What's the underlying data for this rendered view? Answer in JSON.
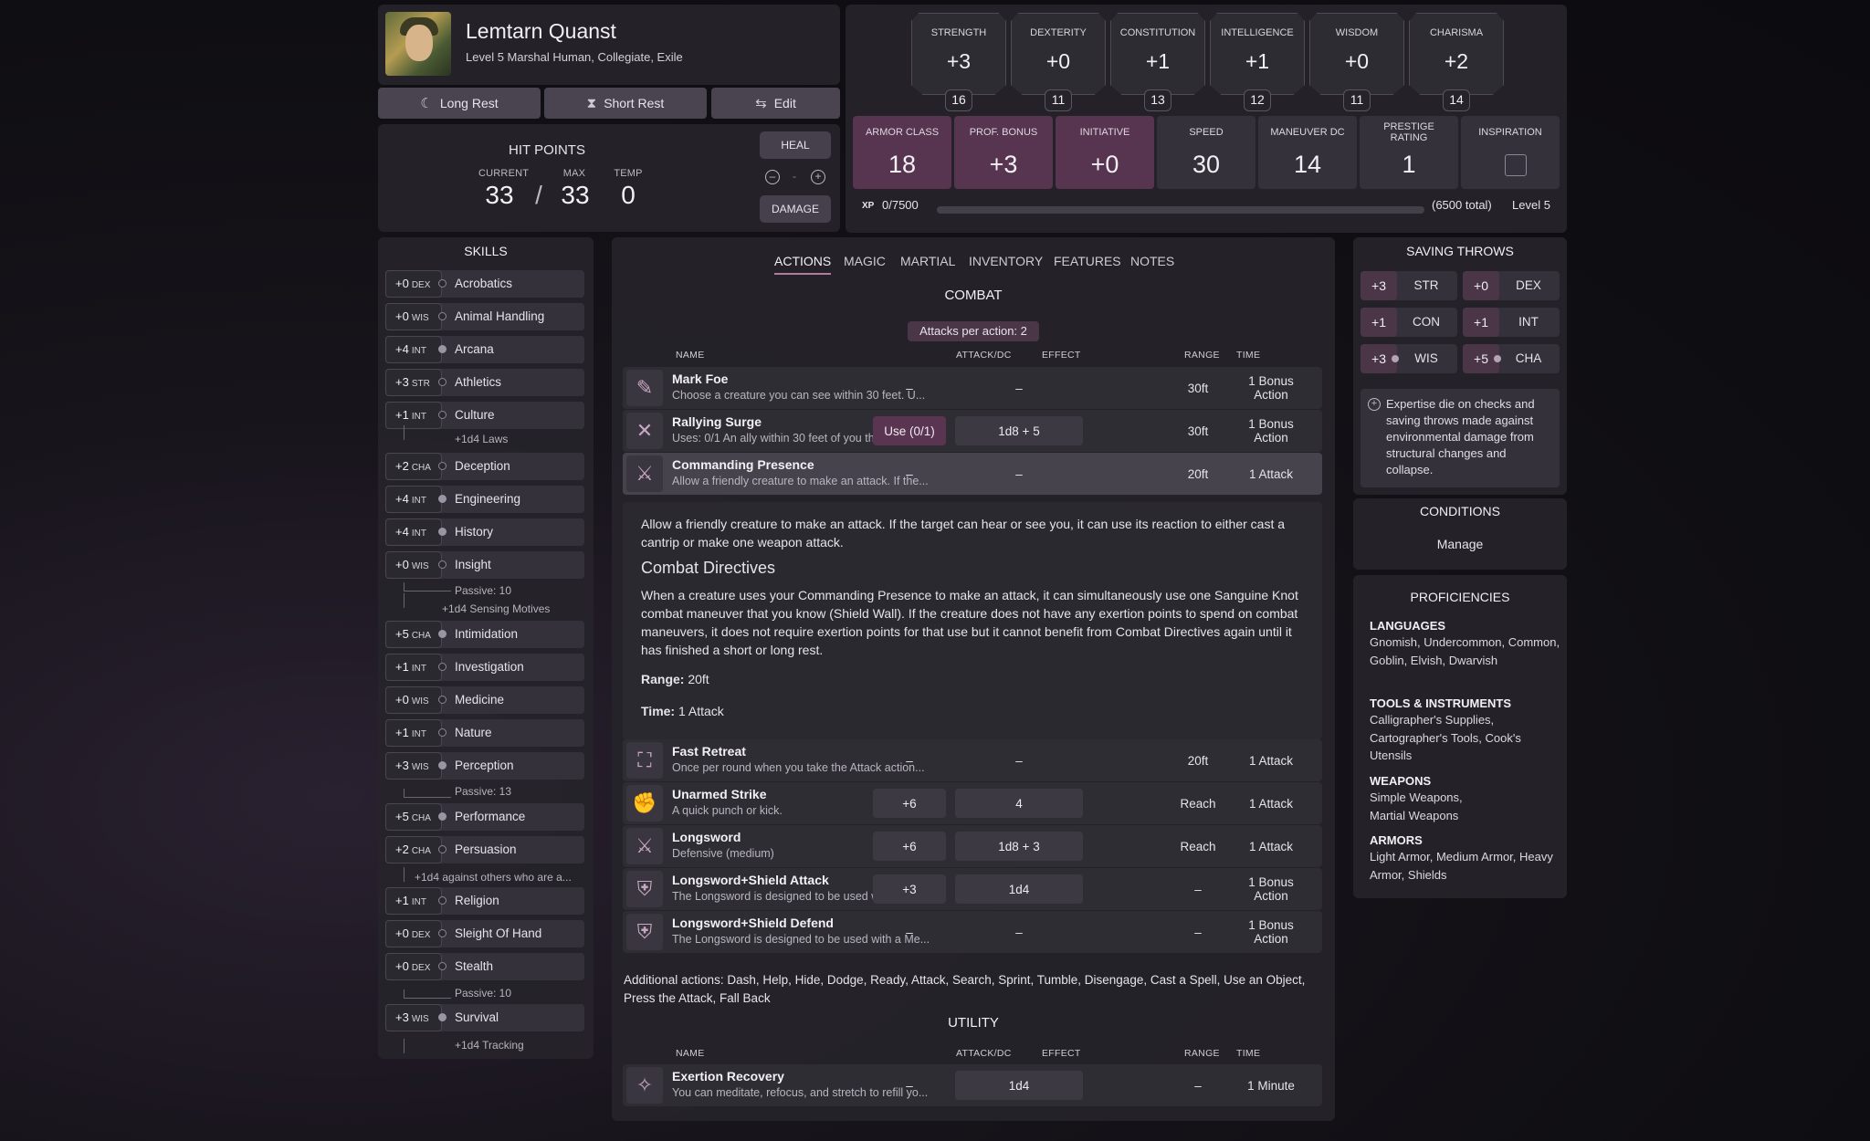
{
  "character": {
    "name": "Lemtarn Quanst",
    "subtitle": "Level 5 Marshal Human, Collegiate, Exile"
  },
  "buttons": {
    "long_rest": "Long Rest",
    "short_rest": "Short Rest",
    "edit": "Edit",
    "heal": "HEAL",
    "damage": "DAMAGE",
    "minus": "–",
    "plus": "+",
    "dash": "-"
  },
  "hp": {
    "title": "HIT POINTS",
    "current_label": "CURRENT",
    "max_label": "MAX",
    "temp_label": "TEMP",
    "current": "33",
    "sep": "/",
    "max": "33",
    "temp": "0"
  },
  "abilities": [
    {
      "name": "STRENGTH",
      "mod": "+3",
      "score": "16"
    },
    {
      "name": "DEXTERITY",
      "mod": "+0",
      "score": "11"
    },
    {
      "name": "CONSTITUTION",
      "mod": "+1",
      "score": "13"
    },
    {
      "name": "INTELLIGENCE",
      "mod": "+1",
      "score": "12"
    },
    {
      "name": "WISDOM",
      "mod": "+0",
      "score": "11"
    },
    {
      "name": "CHARISMA",
      "mod": "+2",
      "score": "14"
    }
  ],
  "stats": [
    {
      "name": "ARMOR CLASS",
      "value": "18"
    },
    {
      "name": "PROF. BONUS",
      "value": "+3"
    },
    {
      "name": "INITIATIVE",
      "value": "+0"
    },
    {
      "name": "SPEED",
      "value": "30"
    },
    {
      "name": "MANEUVER DC",
      "value": "14"
    },
    {
      "name": "PRESTIGE RATING",
      "value": "1"
    },
    {
      "name": "INSPIRATION",
      "value": ""
    }
  ],
  "xp": {
    "label": "XP",
    "value": "0/7500",
    "total": "(6500 total)",
    "level": "Level 5",
    "progress": 0
  },
  "skills_title": "SKILLS",
  "skills": [
    {
      "mod": "+0",
      "abbr": "DEX",
      "name": "Acrobatics",
      "prof": false
    },
    {
      "mod": "+0",
      "abbr": "WIS",
      "name": "Animal Handling",
      "prof": false
    },
    {
      "mod": "+4",
      "abbr": "INT",
      "name": "Arcana",
      "prof": true
    },
    {
      "mod": "+3",
      "abbr": "STR",
      "name": "Athletics",
      "prof": false
    },
    {
      "mod": "+1",
      "abbr": "INT",
      "name": "Culture",
      "prof": false
    },
    {
      "mod": "+2",
      "abbr": "CHA",
      "name": "Deception",
      "prof": false
    },
    {
      "mod": "+4",
      "abbr": "INT",
      "name": "Engineering",
      "prof": true
    },
    {
      "mod": "+4",
      "abbr": "INT",
      "name": "History",
      "prof": true
    },
    {
      "mod": "+0",
      "abbr": "WIS",
      "name": "Insight",
      "prof": false
    },
    {
      "mod": "+5",
      "abbr": "CHA",
      "name": "Intimidation",
      "prof": true
    },
    {
      "mod": "+1",
      "abbr": "INT",
      "name": "Investigation",
      "prof": false
    },
    {
      "mod": "+0",
      "abbr": "WIS",
      "name": "Medicine",
      "prof": false
    },
    {
      "mod": "+1",
      "abbr": "INT",
      "name": "Nature",
      "prof": false
    },
    {
      "mod": "+3",
      "abbr": "WIS",
      "name": "Perception",
      "prof": true
    },
    {
      "mod": "+5",
      "abbr": "CHA",
      "name": "Performance",
      "prof": true
    },
    {
      "mod": "+2",
      "abbr": "CHA",
      "name": "Persuasion",
      "prof": false
    },
    {
      "mod": "+1",
      "abbr": "INT",
      "name": "Religion",
      "prof": false
    },
    {
      "mod": "+0",
      "abbr": "DEX",
      "name": "Sleight Of Hand",
      "prof": false
    },
    {
      "mod": "+0",
      "abbr": "DEX",
      "name": "Stealth",
      "prof": false
    },
    {
      "mod": "+3",
      "abbr": "WIS",
      "name": "Survival",
      "prof": true
    }
  ],
  "skill_notes": {
    "culture": "+1d4 Laws",
    "insight_passive": "Passive: 10",
    "insight_extra": "+1d4 Sensing Motives",
    "perception_passive": "Passive: 13",
    "persuasion": "+1d4 against others who are a...",
    "stealth_passive": "Passive: 10",
    "survival": "+1d4 Tracking"
  },
  "tabs": [
    "ACTIONS",
    "MAGIC",
    "MARTIAL",
    "INVENTORY",
    "FEATURES",
    "NOTES"
  ],
  "combat": {
    "title": "COMBAT",
    "attacks_per_action": "Attacks per action: 2",
    "headers": {
      "name": "NAME",
      "attack": "ATTACK/DC",
      "effect": "EFFECT",
      "range": "RANGE",
      "time": "TIME"
    },
    "rows": [
      {
        "name": "Mark Foe",
        "desc": "Choose a creature you can see within 30 feet. U...",
        "attack": "–",
        "effect": "–",
        "range": "30ft",
        "time": "1 Bonus Action"
      },
      {
        "name": "Rallying Surge",
        "desc": "Uses: 0/1 An ally within 30 feet of you that can h...",
        "attack": "Use (0/1)",
        "effect": "1d8 + 5",
        "range": "30ft",
        "time": "1 Bonus Action"
      },
      {
        "name": "Commanding Presence",
        "desc": "Allow a friendly creature to make an attack. If the...",
        "attack": "–",
        "effect": "–",
        "range": "20ft",
        "time": "1 Attack"
      },
      {
        "name": "Fast Retreat",
        "desc": "Once per round when you take the Attack action...",
        "attack": "–",
        "effect": "–",
        "range": "20ft",
        "time": "1 Attack"
      },
      {
        "name": "Unarmed Strike",
        "desc": "A quick punch or kick.",
        "attack": "+6",
        "effect": "4",
        "range": "Reach",
        "time": "1 Attack"
      },
      {
        "name": "Longsword",
        "desc": "Defensive (medium)",
        "attack": "+6",
        "effect": "1d8 + 3",
        "range": "Reach",
        "time": "1 Attack"
      },
      {
        "name": "Longsword+Shield Attack",
        "desc": "The Longsword is designed to be used with a Me...",
        "attack": "+3",
        "effect": "1d4",
        "range": "–",
        "time": "1 Bonus Action"
      },
      {
        "name": "Longsword+Shield Defend",
        "desc": "The Longsword is designed to be used with a Me...",
        "attack": "–",
        "effect": "–",
        "range": "–",
        "time": "1 Bonus Action"
      }
    ],
    "detail": {
      "p1": "Allow a friendly creature to make an attack. If the target can hear or see you, it can use its reaction to either cast a cantrip or make one weapon attack.",
      "heading": "Combat Directives",
      "p2": "When a creature uses your Commanding Presence to make an attack, it can simultaneously use one Sanguine Knot combat maneuver that you know (Shield Wall). If the creature does not have any exertion points to spend on combat maneuvers, it does not require exertion points for that use but it cannot benefit from Combat Directives again until it has finished a short or long rest.",
      "range_label": "Range:",
      "range": "20ft",
      "time_label": "Time:",
      "time": "1 Attack"
    },
    "additional_label": "Additional actions:",
    "additional": "Dash, Help, Hide, Dodge, Ready, Attack, Search, Sprint, Tumble, Disengage, Cast a Spell, Use an Object,",
    "additional2": "Press the Attack, Fall Back"
  },
  "utility": {
    "title": "UTILITY",
    "rows": [
      {
        "name": "Exertion Recovery",
        "desc": "You can meditate, refocus, and stretch to refill yo...",
        "attack": "–",
        "effect": "1d4",
        "range": "–",
        "time": "1 Minute"
      }
    ]
  },
  "saves": {
    "title": "SAVING THROWS",
    "items": [
      {
        "mod": "+3",
        "name": "STR"
      },
      {
        "mod": "+0",
        "name": "DEX"
      },
      {
        "mod": "+1",
        "name": "CON"
      },
      {
        "mod": "+1",
        "name": "INT"
      },
      {
        "mod": "+3",
        "name": "WIS"
      },
      {
        "mod": "+5",
        "name": "CHA"
      }
    ],
    "note": "Expertise die on checks and saving throws made against environmental damage from structural changes and collapse."
  },
  "conditions": {
    "title": "CONDITIONS",
    "manage": "Manage"
  },
  "proficiencies": {
    "title": "PROFICIENCIES",
    "languages_h": "LANGUAGES",
    "languages": "Gnomish, Undercommon, Common, Goblin, Elvish, Dwarvish",
    "tools_h": "TOOLS & INSTRUMENTS",
    "tools": "Calligrapher's Supplies, Cartographer's Tools, Cook's Utensils",
    "weapons_h": "WEAPONS",
    "weapons": "Simple Weapons, Martial Weapons",
    "armors_h": "ARMORS",
    "armors": "Light Armor, Medium Armor, Heavy Armor, Shields"
  },
  "colors": {
    "accent": "#b07ca6",
    "highlight": "#57344f"
  }
}
